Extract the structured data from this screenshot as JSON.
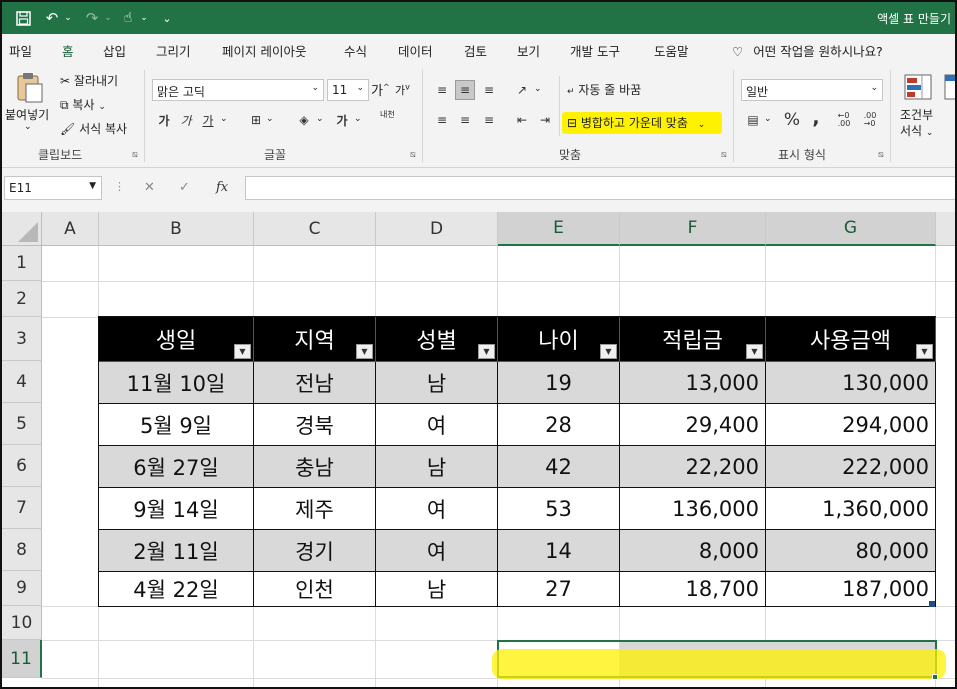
{
  "title_bar": {
    "title": "액셀 표 만들기"
  },
  "ribbon_tabs": [
    "파일",
    "홈",
    "삽입",
    "그리기",
    "페이지 레이아웃",
    "수식",
    "데이터",
    "검토",
    "보기",
    "개발 도구",
    "도움말"
  ],
  "active_tab": "홈",
  "tell_me": "어떤 작업을 원하시나요?",
  "clipboard": {
    "paste": "붙여넣기",
    "cut": "잘라내기",
    "copy": "복사",
    "format_painter": "서식 복사",
    "group": "클립보드"
  },
  "font": {
    "name": "맑은 고딕",
    "size": "11",
    "grow": "가",
    "shrink": "가",
    "bold": "가",
    "italic": "가",
    "underline": "가",
    "phonetic": "내천",
    "group": "글꼴"
  },
  "alignment": {
    "wrap_text": "자동 줄 바꿈",
    "merge_center": "병합하고 가운데 맞춤",
    "group": "맞춤"
  },
  "number": {
    "format": "일반",
    "percent": "%",
    "comma": ",",
    "group": "표시 형식"
  },
  "styles": {
    "conditional_top": "조건부",
    "conditional_bottom": "서식"
  },
  "name_box": "E11",
  "formula_bar": {
    "cancel": "✕",
    "enter": "✓",
    "fx": "fx",
    "value": ""
  },
  "columns": [
    "A",
    "B",
    "C",
    "D",
    "E",
    "F",
    "G"
  ],
  "rows": [
    "1",
    "2",
    "3",
    "4",
    "5",
    "6",
    "7",
    "8",
    "9",
    "10",
    "11"
  ],
  "table": {
    "headers": [
      "생일",
      "지역",
      "성별",
      "나이",
      "적립금",
      "사용금액"
    ],
    "rows": [
      [
        "11월 10일",
        "전남",
        "남",
        "19",
        "13,000",
        "130,000"
      ],
      [
        "5월 9일",
        "경북",
        "여",
        "28",
        "29,400",
        "294,000"
      ],
      [
        "6월 27일",
        "충남",
        "남",
        "42",
        "22,200",
        "222,000"
      ],
      [
        "9월 14일",
        "제주",
        "여",
        "53",
        "136,000",
        "1,360,000"
      ],
      [
        "2월 11일",
        "경기",
        "여",
        "14",
        "8,000",
        "80,000"
      ],
      [
        "4월 22일",
        "인천",
        "남",
        "27",
        "18,700",
        "187,000"
      ]
    ]
  },
  "colors": {
    "excel_green": "#217346",
    "highlight": "#fff200",
    "band_gray": "#d9d9d9"
  }
}
